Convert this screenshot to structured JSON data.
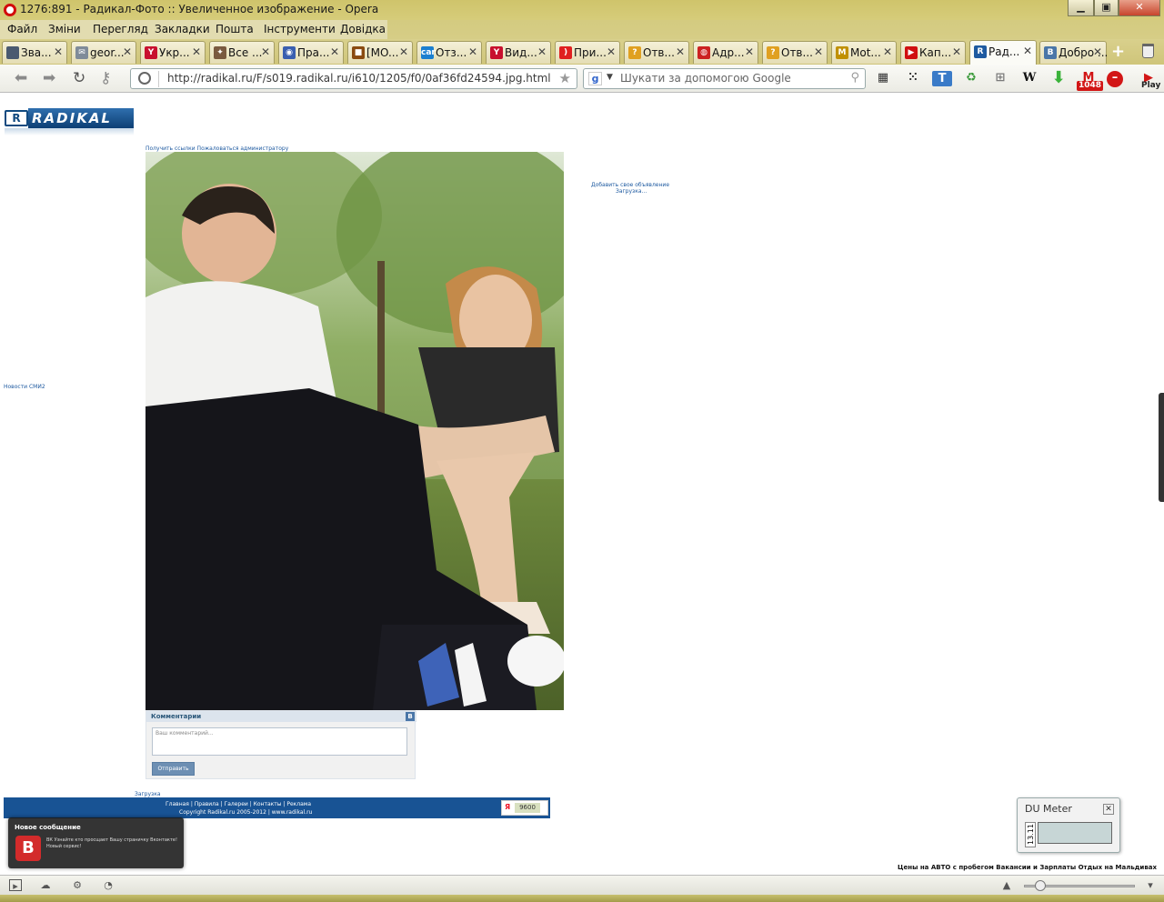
{
  "window": {
    "title": "1276:891 - Радикал-Фото :: Увеличенное изображение - Opera",
    "minimize_glyph": "▁",
    "maximize_glyph": "▣",
    "close_glyph": "✕"
  },
  "menu": [
    "Файл",
    "Зміни",
    "Перегляд",
    "Закладки",
    "Пошта",
    "Інструменти",
    "Довідка"
  ],
  "tabs": [
    {
      "label": "Зва...",
      "fav_text": "",
      "fav_color": "#4a5a70"
    },
    {
      "label": "geor...",
      "fav_text": "✉",
      "fav_color": "#7f8b99"
    },
    {
      "label": "Укр...",
      "fav_text": "Y",
      "fav_color": "#c8102e"
    },
    {
      "label": "Все ...",
      "fav_text": "✦",
      "fav_color": "#7a5a40"
    },
    {
      "label": "Пра...",
      "fav_text": "◉",
      "fav_color": "#3a5fb0"
    },
    {
      "label": "[MO...",
      "fav_text": "■",
      "fav_color": "#8a4a10"
    },
    {
      "label": "Отз...",
      "fav_text": "car",
      "fav_color": "#1b7fd0"
    },
    {
      "label": "Вид...",
      "fav_text": "Y",
      "fav_color": "#c8102e"
    },
    {
      "label": "При...",
      "fav_text": ")",
      "fav_color": "#e02020"
    },
    {
      "label": "Отв...",
      "fav_text": "?",
      "fav_color": "#e0a020"
    },
    {
      "label": "Адр...",
      "fav_text": "◍",
      "fav_color": "#cc2222"
    },
    {
      "label": "Отв...",
      "fav_text": "?",
      "fav_color": "#e0a020"
    },
    {
      "label": "Mot...",
      "fav_text": "M",
      "fav_color": "#c09000"
    },
    {
      "label": "Кап...",
      "fav_text": "▶",
      "fav_color": "#d01010"
    },
    {
      "label": "Рад...",
      "fav_text": "R",
      "fav_color": "#1e5aa0"
    },
    {
      "label": "Добро ...",
      "fav_text": "B",
      "fav_color": "#4a76a8"
    }
  ],
  "address": {
    "url": "http://radikal.ru/F/s019.radikal.ru/i610/1205/f0/0af36fd24594.jpg.html"
  },
  "search": {
    "placeholder": "Шукати за допомогою Google"
  },
  "toolbar": {
    "badge_count": "1048",
    "play_label": "Play"
  },
  "page": {
    "logo_r": "R",
    "logo_word": "RADIKAL FOTO",
    "top_links": "Получить ссылки   Пожаловаться администратору",
    "ad_link": "Добавить свое объявление",
    "ad_loading": "Загрузка...",
    "news_link": "Новости СМИ2",
    "comments_title": "Комментарии",
    "comment_placeholder": "Ваш комментарий...",
    "send_button": "Отправить",
    "bottom_loading": "Загрузка",
    "footer_links": "Главная  |  Правила  |  Галереи  |  Контакты  |  Реклама",
    "footer_copy": "Copyright Radikal.ru 2005-2012  |  www.radikal.ru",
    "counter_value": "9600",
    "bottom_ads": "Цены на АВТО с пробегом   Вакансии и Зарплаты   Отдых на Мальдивах"
  },
  "notification": {
    "title": "Новое сообщение",
    "icon_letter": "В",
    "text": "ВК Узнайте кто просщает Вашу страничку Вконтакте! Новый сервис!"
  },
  "du_meter": {
    "title": "DU Meter",
    "scale_value": "13.11"
  }
}
